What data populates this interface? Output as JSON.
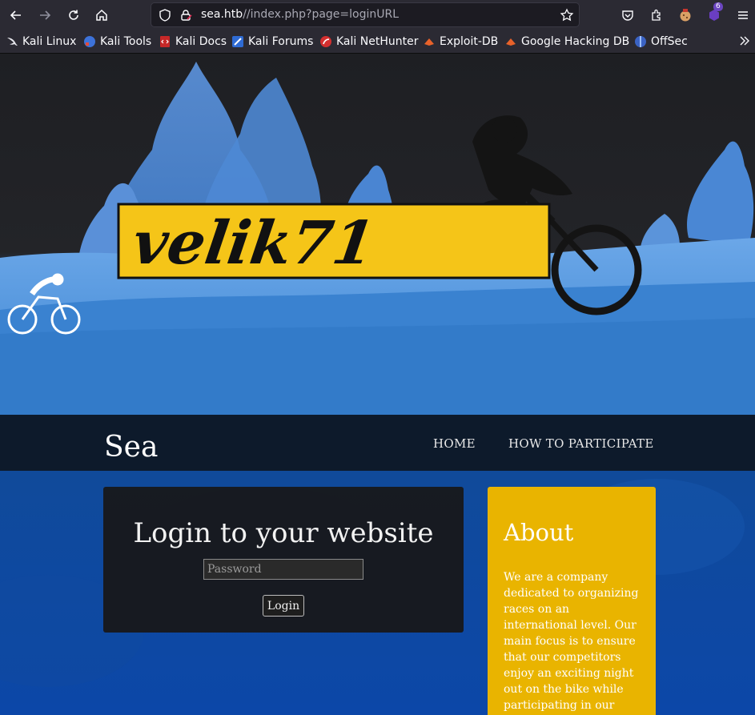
{
  "browser": {
    "url_host": "sea.htb",
    "url_path": "//index.php?page=loginURL",
    "extension_badge": "6",
    "bookmarks": [
      {
        "label": "Kali Linux",
        "icon": "kali-dragon-icon"
      },
      {
        "label": "Kali Tools",
        "icon": "kali-tools-icon"
      },
      {
        "label": "Kali Docs",
        "icon": "kali-docs-icon"
      },
      {
        "label": "Kali Forums",
        "icon": "kali-forums-icon"
      },
      {
        "label": "Kali NetHunter",
        "icon": "kali-nethunter-icon"
      },
      {
        "label": "Exploit-DB",
        "icon": "exploit-db-icon"
      },
      {
        "label": "Google Hacking DB",
        "icon": "ghdb-icon"
      },
      {
        "label": "OffSec",
        "icon": "offsec-icon"
      }
    ]
  },
  "hero": {
    "logo_text": "velik71"
  },
  "navbar": {
    "site_title": "Sea",
    "links": [
      "HOME",
      "HOW TO PARTICIPATE"
    ]
  },
  "login": {
    "title": "Login to your website",
    "password_placeholder": "Password",
    "button_label": "Login"
  },
  "about": {
    "heading": "About",
    "body": "We are a company dedicated to organizing races on an international level. Our main focus is to ensure that our competitors enjoy an exciting night out on the bike while participating in our"
  },
  "colors": {
    "browser_chrome": "#2b2a33",
    "navbar": "#0d1a2b",
    "content_blue": "#0c47a8",
    "about_panel": "#e9b400",
    "logo_yellow": "#f5c518"
  }
}
